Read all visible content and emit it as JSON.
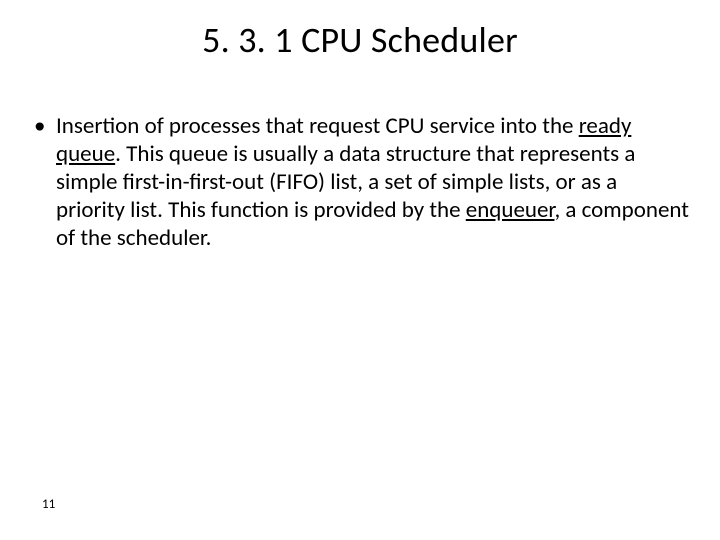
{
  "slide": {
    "title": "5. 3. 1 CPU Scheduler",
    "bullet": {
      "part1": "Insertion of processes that request CPU service into the ",
      "u1": "ready queue",
      "part2": ". This queue is usually a data structure that represents a simple first-in-first-out (FIFO) list, a set of simple lists, or as a priority list. This function is provided by the ",
      "u2": "enqueuer",
      "part3": ", a component of the scheduler."
    },
    "page_number": "11"
  }
}
